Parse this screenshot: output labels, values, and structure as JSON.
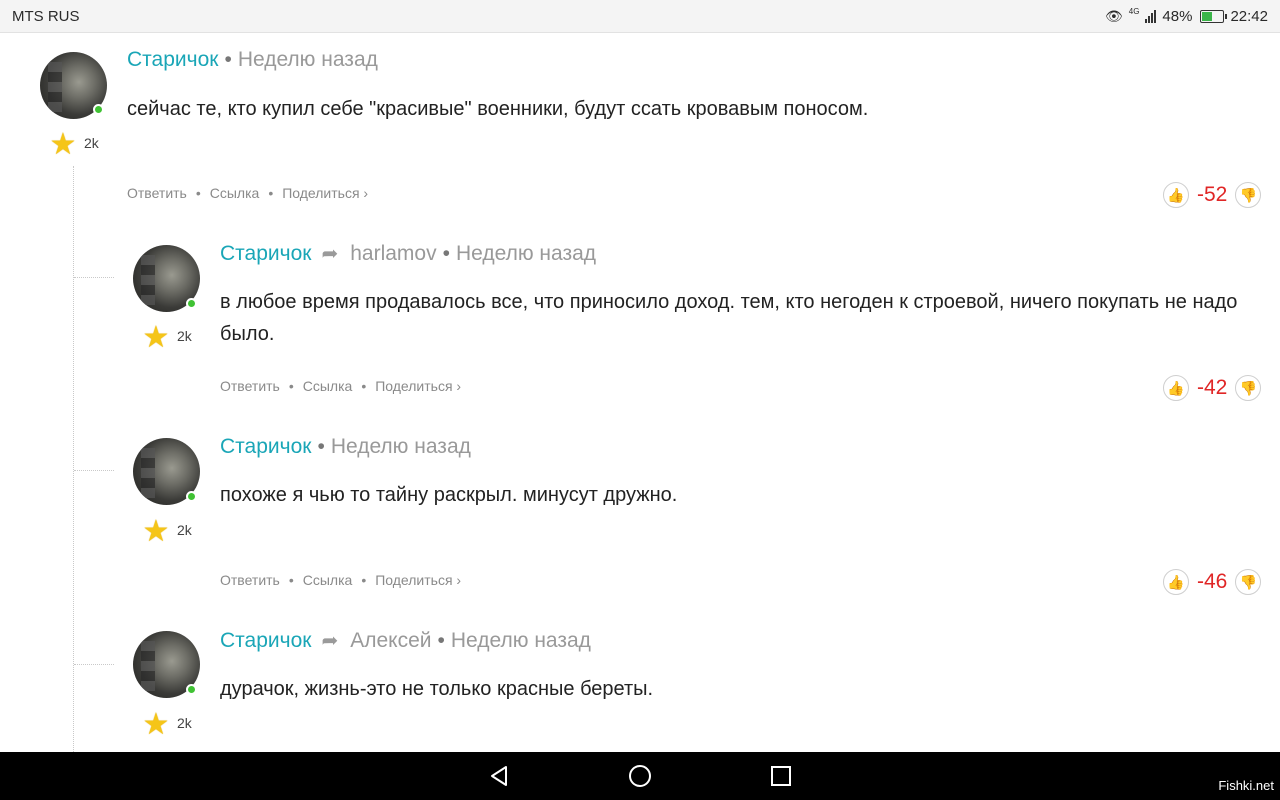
{
  "status_bar": {
    "carrier": "MTS RUS",
    "network": "4G",
    "battery_percent": "48%",
    "time": "22:42"
  },
  "comments": [
    {
      "author": "Старичок",
      "reply_to": "",
      "time": "Неделю назад",
      "text": "сейчас те, кто купил себе \"красивые\" военники, будут ссать кровавым поносом.",
      "karma": "2k",
      "score": "-52"
    },
    {
      "author": "Старичок",
      "reply_to": "harlamov",
      "time": "Неделю назад",
      "text": "в любое время продавалось все, что приносило доход. тем, кто негоден к строевой, ничего покупать не надо было.",
      "karma": "2k",
      "score": "-42"
    },
    {
      "author": "Старичок",
      "reply_to": "",
      "time": "Неделю назад",
      "text": "похоже я чью то тайну раскрыл. минусут дружно.",
      "karma": "2k",
      "score": "-46"
    },
    {
      "author": "Старичок",
      "reply_to": "Алексей",
      "time": "Неделю назад",
      "text": "дурачок, жизнь-это не только красные береты.",
      "karma": "2k",
      "score": ""
    }
  ],
  "actions": {
    "reply": "Ответить",
    "link": "Ссылка",
    "share": "Поделиться ›"
  },
  "icons": {
    "star": "star-icon",
    "reply_arrow": "reply-arrow-icon",
    "like": "thumb-up-icon",
    "dislike": "thumb-down-icon"
  },
  "watermark": "Fishki.net",
  "colors": {
    "author": "#1aa6b7",
    "score_negative": "#e02626",
    "online": "#40c234"
  }
}
